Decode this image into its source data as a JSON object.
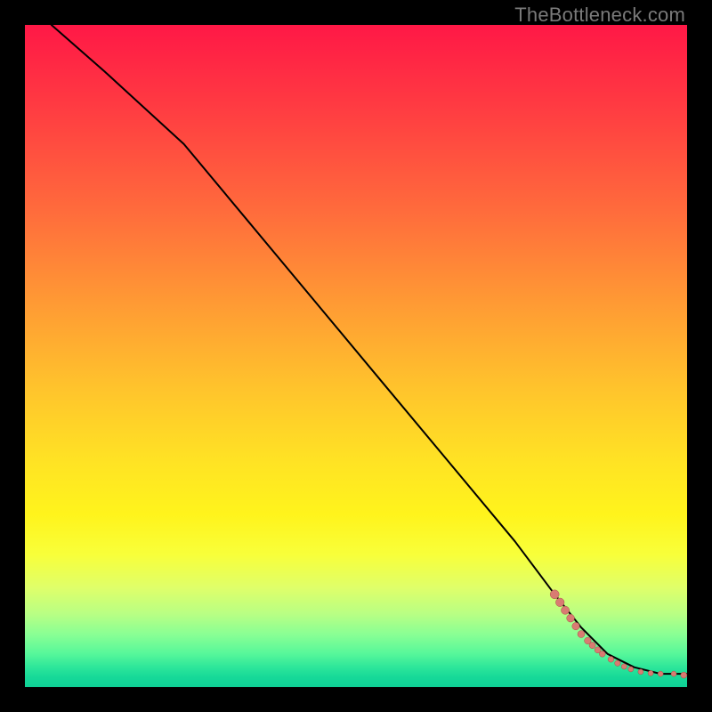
{
  "watermark": "TheBottleneck.com",
  "colors": {
    "line": "#000000",
    "dot_fill": "#d97b72",
    "dot_stroke": "#a84f46"
  },
  "chart_data": {
    "type": "line",
    "title": "",
    "xlabel": "",
    "ylabel": "",
    "xlim": [
      0,
      100
    ],
    "ylim": [
      0,
      100
    ],
    "annotations": [
      "TheBottleneck.com"
    ],
    "series": [
      {
        "name": "curve",
        "x": [
          4,
          12,
          24,
          34,
          44,
          54,
          64,
          74,
          80,
          84,
          88,
          92,
          96,
          98,
          100
        ],
        "y": [
          100,
          93,
          82,
          70,
          58,
          46,
          34,
          22,
          14,
          9,
          5,
          3,
          2,
          2,
          2
        ]
      }
    ],
    "scatter": {
      "name": "dots",
      "x": [
        80.0,
        80.8,
        81.6,
        82.4,
        83.2,
        84.0,
        85.0,
        85.7,
        86.5,
        87.2,
        88.5,
        89.5,
        90.5,
        91.5,
        93.0,
        94.5,
        96.0,
        98.0,
        99.5
      ],
      "y": [
        14.0,
        12.8,
        11.6,
        10.4,
        9.2,
        8.0,
        7.0,
        6.3,
        5.6,
        5.0,
        4.2,
        3.6,
        3.1,
        2.7,
        2.3,
        2.1,
        2.0,
        2.0,
        1.8
      ],
      "r": [
        5.0,
        4.8,
        4.6,
        4.4,
        4.2,
        4.0,
        3.8,
        3.6,
        3.5,
        3.4,
        3.3,
        3.2,
        3.1,
        3.0,
        3.0,
        3.0,
        3.0,
        3.0,
        3.5
      ]
    }
  }
}
